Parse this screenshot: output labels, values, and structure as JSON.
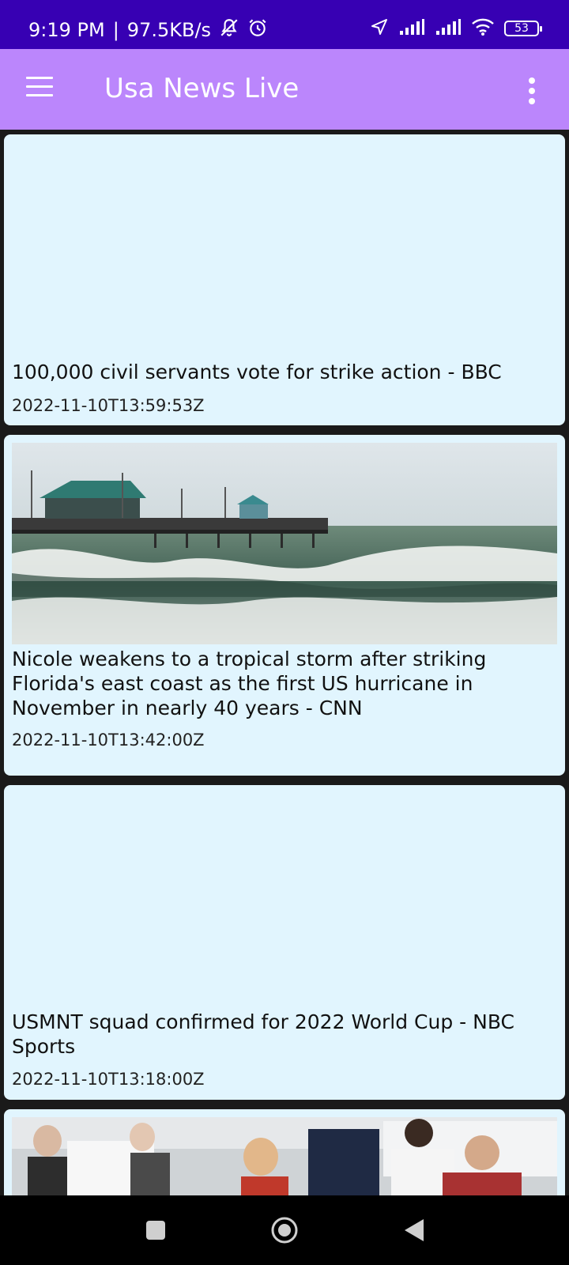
{
  "status_bar": {
    "time": "9:19 PM",
    "separator": "|",
    "speed": "97.5KB/s",
    "battery": "53",
    "icons": [
      "muted-notification-icon",
      "alarm-icon",
      "location-arrow-icon",
      "signal-icon",
      "signal-icon",
      "wifi-icon",
      "battery-icon"
    ]
  },
  "app_bar": {
    "title": "Usa News Live",
    "menu_icon": "hamburger-menu-icon",
    "overflow_icon": "more-vertical-icon"
  },
  "articles": [
    {
      "title": "100,000 civil servants vote for strike action - BBC",
      "date": "2022-11-10T13:59:53Z",
      "has_image": false
    },
    {
      "title": "Nicole weakens to a tropical storm after striking Florida's east coast as the first US hurricane in November in nearly 40 years - CNN",
      "date": "2022-11-10T13:42:00Z",
      "has_image": true,
      "image": "storm-pier-photo"
    },
    {
      "title": "USMNT squad confirmed for 2022 World Cup - NBC Sports",
      "date": "2022-11-10T13:18:00Z",
      "has_image": false
    },
    {
      "title": "",
      "date": "",
      "has_image": true,
      "image": "vaccination-clinic-photo"
    }
  ],
  "nav_bar": {
    "icons": [
      "recent-apps-icon",
      "home-icon",
      "back-icon"
    ]
  },
  "colors": {
    "status_bar": "#3700b3",
    "app_bar": "#bb86fc",
    "card_background": "#e1f5fe",
    "page_background": "#1a1a1a",
    "nav_bar": "#000000"
  }
}
